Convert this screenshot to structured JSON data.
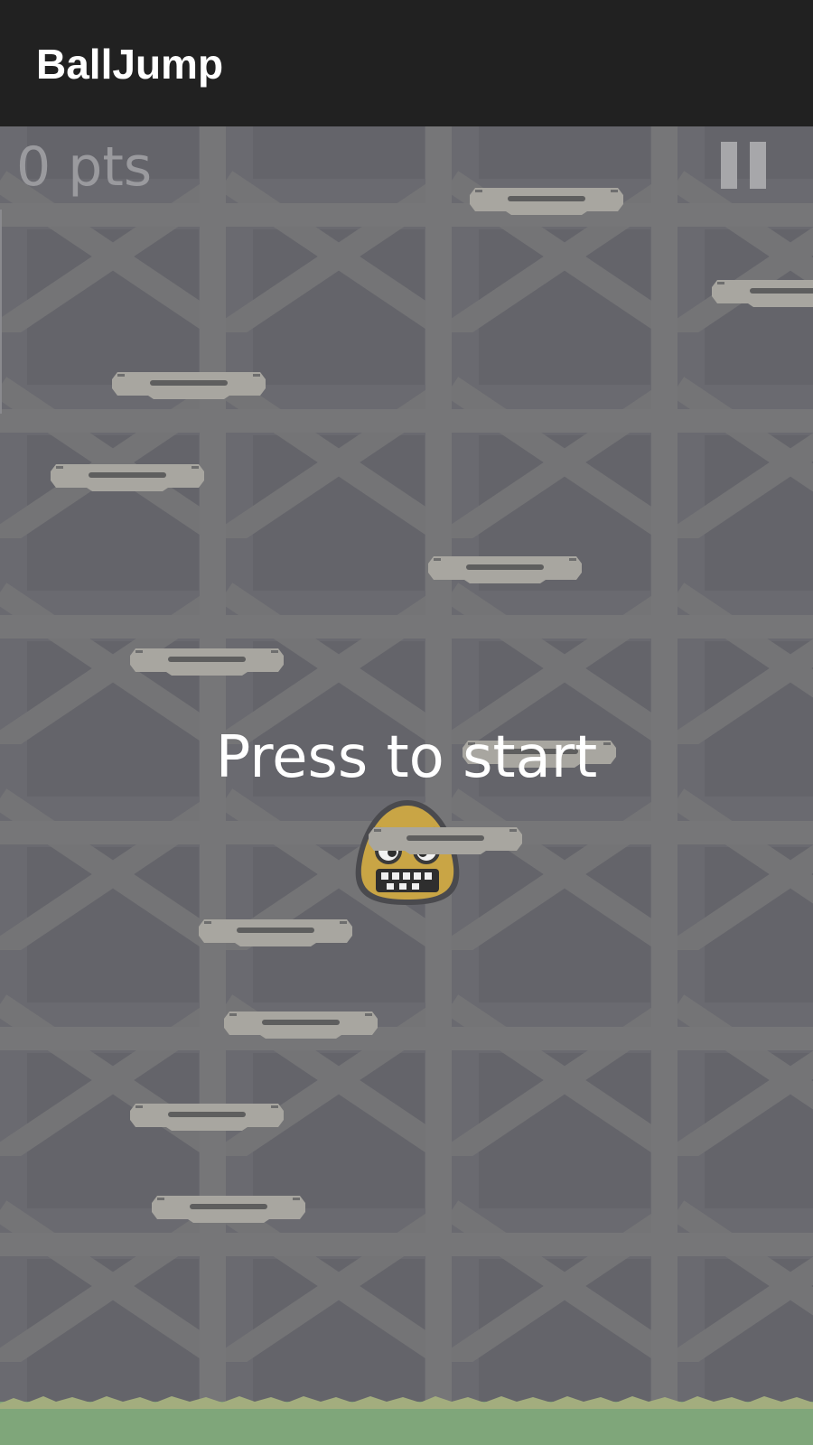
{
  "app": {
    "title": "BallJump"
  },
  "hud": {
    "score_text": "0 pts",
    "pause_icon": "pause-icon"
  },
  "overlay": {
    "start_text": "Press to start"
  },
  "colors": {
    "app_bar": "#212121",
    "background": "#6a6a70",
    "girder": "#777779",
    "platform": "#a8a6a0",
    "character": "#c9a545",
    "grass": "#7fa67a"
  }
}
